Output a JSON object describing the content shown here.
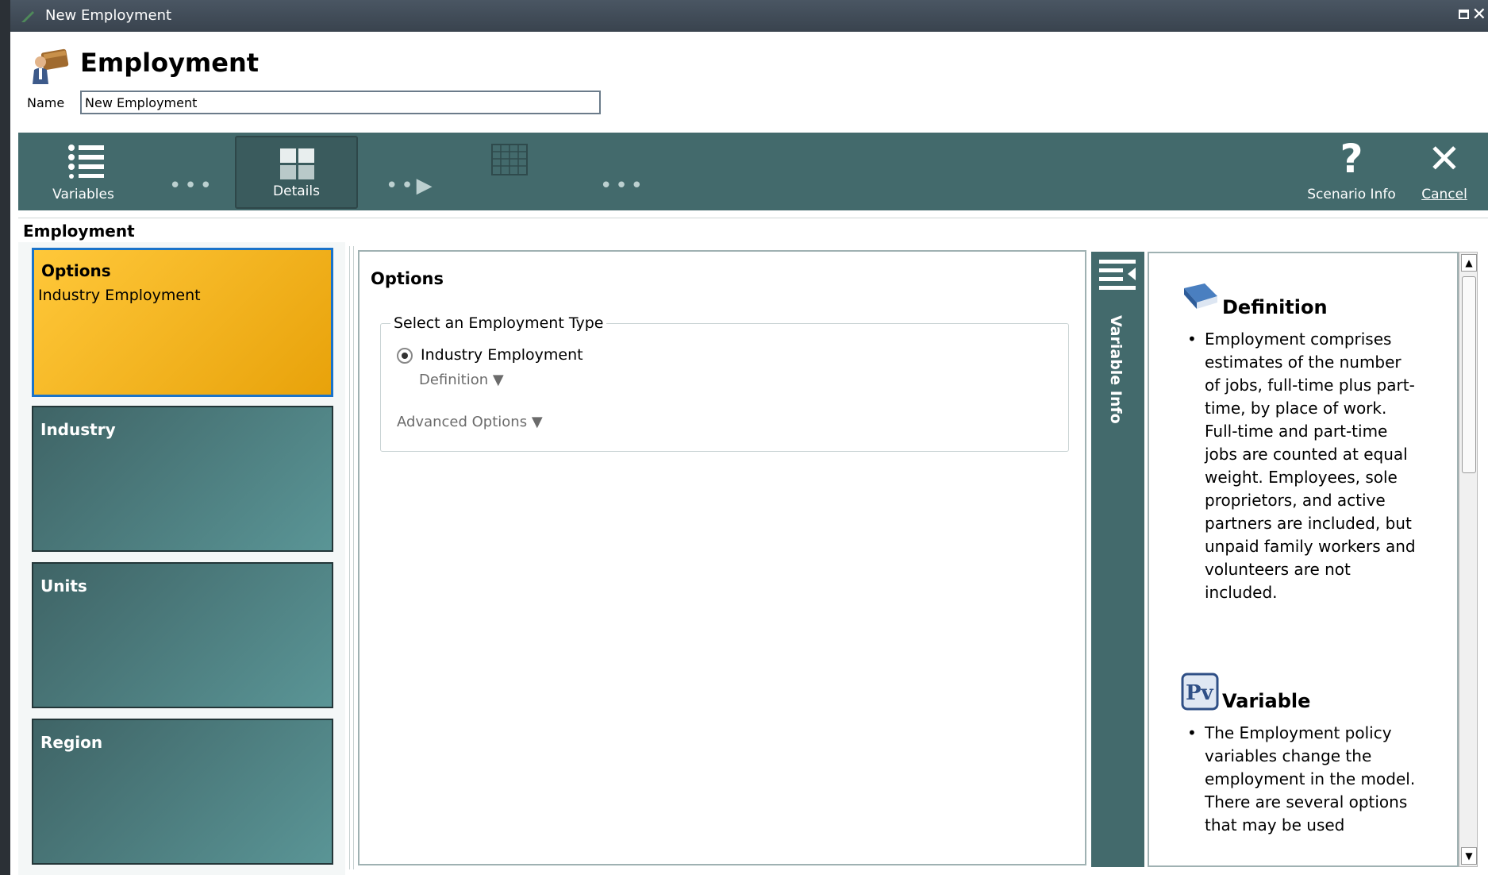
{
  "window": {
    "title": "New Employment"
  },
  "header": {
    "title": "Employment",
    "name_label": "Name",
    "name_value": "New Employment"
  },
  "toolbar": {
    "items": [
      {
        "label": "Variables",
        "icon": "list-icon"
      },
      {
        "label": "Details",
        "icon": "grid-icon"
      },
      {
        "label": "Scenario Info",
        "icon": "question-icon"
      },
      {
        "label": "Cancel",
        "icon": "close-icon"
      }
    ]
  },
  "section": {
    "title": "Employment"
  },
  "tiles": [
    {
      "title": "Options",
      "subtitle": "Industry Employment"
    },
    {
      "title": "Industry"
    },
    {
      "title": "Units"
    },
    {
      "title": "Region"
    }
  ],
  "options": {
    "title": "Options",
    "group_label": "Select an Employment Type",
    "radio_label": "Industry Employment",
    "definition_expander": "Definition",
    "advanced_expander": "Advanced Options"
  },
  "variable_info": {
    "tab_label": "Variable Info",
    "definition_title": "Definition",
    "definition_text": "Employment comprises estimates of the number of jobs, full-time plus part-time, by place of work. Full-time and part-time jobs are counted at equal weight. Employees, sole proprietors, and active partners are included, but unpaid family workers and volunteers are not included.",
    "variable_title": "Variable",
    "variable_text": "The Employment policy variables change the employment in the model. There are several options that may be used"
  },
  "colors": {
    "toolbar": "#436a6c",
    "selected_tile": "#f5b320",
    "tile": "#4d7f80"
  }
}
